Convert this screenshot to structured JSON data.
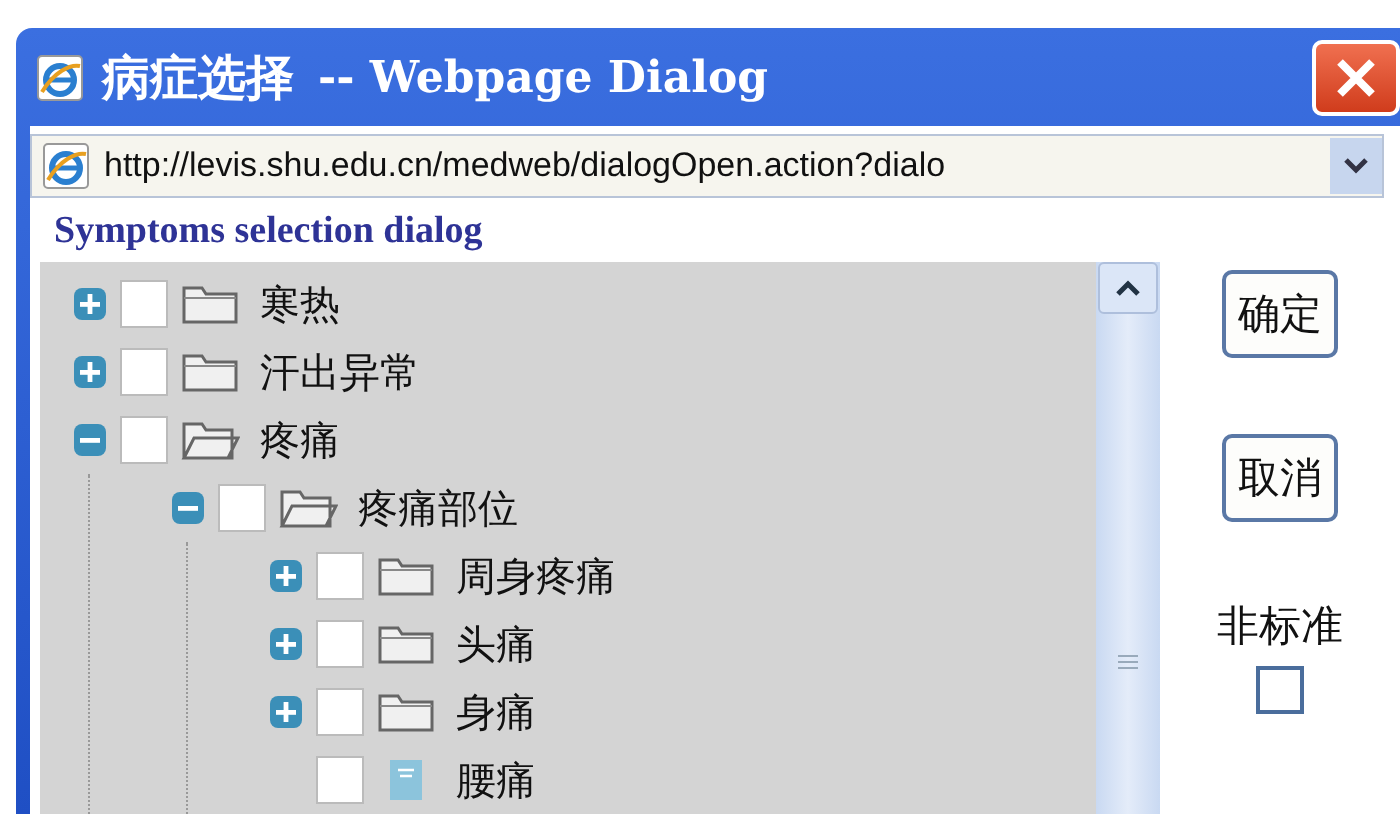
{
  "window": {
    "title": "病症选择",
    "title_suffix": "-- Webpage Dialog"
  },
  "address_bar": {
    "url": "http://levis.shu.edu.cn/medweb/dialogOpen.action?dialo"
  },
  "heading": "Symptoms selection dialog",
  "tree": [
    {
      "label": "寒热",
      "kind": "folder",
      "expanded": false,
      "checked": false
    },
    {
      "label": "汗出异常",
      "kind": "folder",
      "expanded": false,
      "checked": false
    },
    {
      "label": "疼痛",
      "kind": "folder",
      "expanded": true,
      "checked": false,
      "children": [
        {
          "label": "疼痛部位",
          "kind": "folder",
          "expanded": true,
          "checked": false,
          "children": [
            {
              "label": "周身疼痛",
              "kind": "folder",
              "expanded": false,
              "checked": false
            },
            {
              "label": "头痛",
              "kind": "folder",
              "expanded": false,
              "checked": false
            },
            {
              "label": "身痛",
              "kind": "folder",
              "expanded": false,
              "checked": false
            },
            {
              "label": "腰痛",
              "kind": "leaf",
              "checked": false
            }
          ]
        }
      ]
    }
  ],
  "buttons": [
    "确定",
    "取消"
  ],
  "nonstandard": {
    "label": "非标准",
    "checked": false
  }
}
